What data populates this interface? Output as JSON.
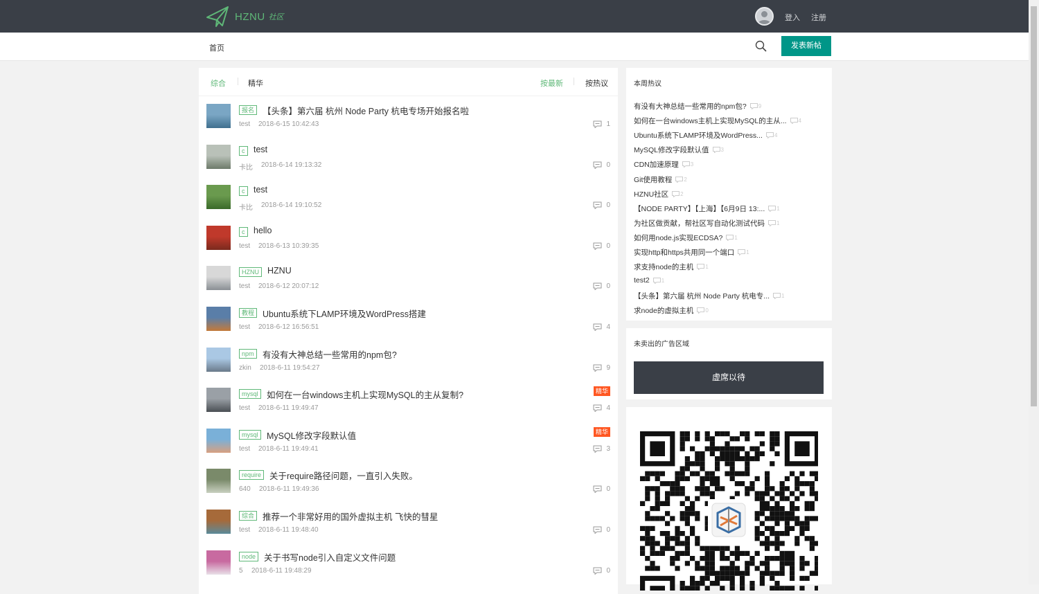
{
  "header": {
    "logo_text": "HZNU",
    "logo_sub": "社区",
    "login": "登入",
    "register": "注册"
  },
  "nav": {
    "home": "首页",
    "post_button": "发表新帖"
  },
  "tabs": {
    "all": "综合",
    "essence": "精华",
    "newest": "按最新",
    "hottest": "按热议"
  },
  "posts": [
    {
      "tag": "报名",
      "title": "【头条】第六届 杭州 Node Party 杭电专场开始报名啦",
      "author": "test",
      "time": "2018-6-15 10:42:43",
      "comments": "1",
      "essence": ""
    },
    {
      "tag": "c",
      "title": "test",
      "author": "卡比",
      "time": "2018-6-14 19:13:32",
      "comments": "0",
      "essence": ""
    },
    {
      "tag": "c",
      "title": "test",
      "author": "卡比",
      "time": "2018-6-14 19:10:52",
      "comments": "0",
      "essence": ""
    },
    {
      "tag": "c",
      "title": "hello",
      "author": "test",
      "time": "2018-6-13 10:39:35",
      "comments": "0",
      "essence": ""
    },
    {
      "tag": "HZNU",
      "title": "HZNU",
      "author": "test",
      "time": "2018-6-12 20:07:12",
      "comments": "0",
      "essence": ""
    },
    {
      "tag": "教程",
      "title": "Ubuntu系统下LAMP环境及WordPress搭建",
      "author": "test",
      "time": "2018-6-12 16:56:51",
      "comments": "4",
      "essence": ""
    },
    {
      "tag": "npm",
      "title": "有没有大神总结一些常用的npm包?",
      "author": "zkin",
      "time": "2018-6-11 19:54:27",
      "comments": "9",
      "essence": ""
    },
    {
      "tag": "mysql",
      "title": "如何在一台windows主机上实现MySQL的主从复制?",
      "author": "test",
      "time": "2018-6-11 19:49:47",
      "comments": "4",
      "essence": "精华"
    },
    {
      "tag": "mysql",
      "title": "MySQL修改字段默认值",
      "author": "test",
      "time": "2018-6-11 19:49:41",
      "comments": "3",
      "essence": "精华"
    },
    {
      "tag": "require",
      "title": "关于require路径问题，一直引入失败。",
      "author": "640",
      "time": "2018-6-11 19:49:36",
      "comments": "0",
      "essence": ""
    },
    {
      "tag": "综合",
      "title": "推荐一个非常好用的国外虚拟主机 飞快的彗星",
      "author": "test",
      "time": "2018-6-11 19:48:40",
      "comments": "0",
      "essence": ""
    },
    {
      "tag": "node",
      "title": "关于书写node引入自定义文件问题",
      "author": "5",
      "time": "2018-6-11 19:48:29",
      "comments": "0",
      "essence": ""
    }
  ],
  "sidebar": {
    "hot_title": "本周热议",
    "hot_items": [
      {
        "title": "有没有大神总结一些常用的npm包?",
        "count": "9"
      },
      {
        "title": "如何在一台windows主机上实现MySQL的主从...",
        "count": "4"
      },
      {
        "title": "Ubuntu系统下LAMP环境及WordPress...",
        "count": "4"
      },
      {
        "title": "MySQL修改字段默认值",
        "count": "3"
      },
      {
        "title": "CDN加速原理",
        "count": "3"
      },
      {
        "title": "Git使用教程",
        "count": "2"
      },
      {
        "title": "HZNU社区",
        "count": "2"
      },
      {
        "title": "【NODE PARTY】【上海】【6月9日 13:...",
        "count": "1"
      },
      {
        "title": "为社区做贡献，帮社区写自动化测试代码",
        "count": "1"
      },
      {
        "title": "如何用node.js实现ECDSA?",
        "count": "1"
      },
      {
        "title": "实现http和https共用同一个端口",
        "count": "1"
      },
      {
        "title": "求支持node的主机",
        "count": "1"
      },
      {
        "title": "test2",
        "count": "1"
      },
      {
        "title": "【头条】第六届 杭州 Node Party 杭电专...",
        "count": "1"
      },
      {
        "title": "求node的虚拟主机",
        "count": "0"
      }
    ],
    "ad_title": "未卖出的广告区域",
    "ad_text": "虚席以待"
  },
  "colors": {
    "accent": "#5fb878",
    "primary_button": "#009688",
    "essence": "#ff5722",
    "topbar": "#3a3f47"
  }
}
